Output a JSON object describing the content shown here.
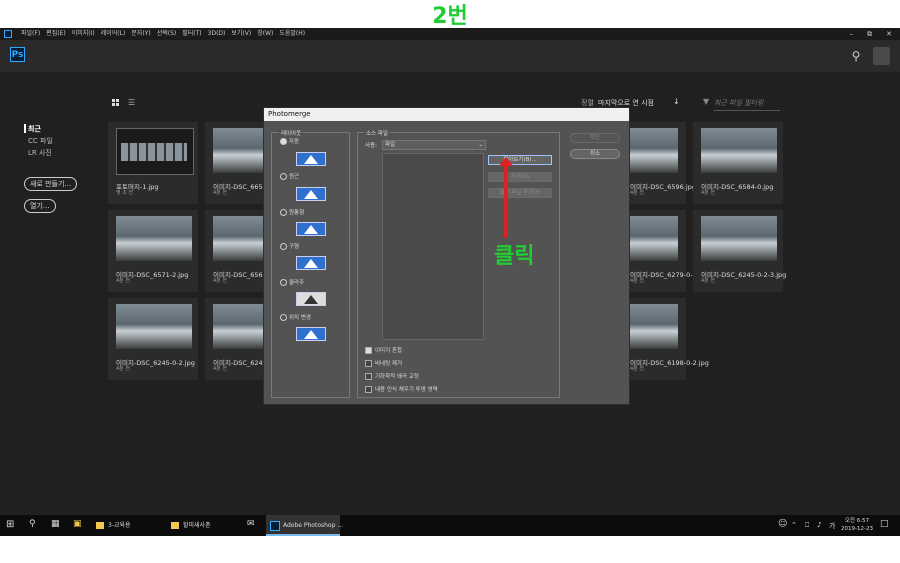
{
  "annotation": {
    "step": "2번",
    "click": "클릭"
  },
  "menubar": {
    "items": [
      "파일(F)",
      "편집(E)",
      "이미지(I)",
      "레이어(L)",
      "문자(Y)",
      "선택(S)",
      "필터(T)",
      "3D(D)",
      "보기(V)",
      "창(W)",
      "도움말(H)"
    ],
    "minimize": "–",
    "restore": "⧉",
    "close": "✕"
  },
  "app": {
    "logo": "Ps"
  },
  "home": {
    "sort_label": "정렬",
    "sort_value": "마지막으로 연 시점",
    "filter_placeholder": "최근 파일 필터링",
    "sidebar": {
      "recent": "최근",
      "cc_files": "CC 파일",
      "lr_photos": "LR 사진",
      "new_button": "새로 만들기...",
      "open_button": "열기..."
    },
    "files": [
      {
        "name": "포토머지-1.jpg",
        "time": "몇 초 전"
      },
      {
        "name": "이미지-DSC_6654",
        "time": "4분 전"
      },
      {
        "name": "이미지-DSC_6596.jpg",
        "time": "4분 전"
      },
      {
        "name": "이미지-DSC_6584-0.jpg",
        "time": "4분 전"
      },
      {
        "name": "이미지-DSC_6571-2.jpg",
        "time": "4분 전"
      },
      {
        "name": "이미지-DSC_6562",
        "time": "4분 전"
      },
      {
        "name": "이미지-DSC_6279-0-2-0.jpg",
        "time": "4분 전"
      },
      {
        "name": "이미지-DSC_6245-0-2-3.jpg",
        "time": "4분 전"
      },
      {
        "name": "이미지-DSC_6245-0-2.jpg",
        "time": "4분 전"
      },
      {
        "name": "이미지-DSC_6245",
        "time": "4분 전"
      },
      {
        "name": "이미지-DSC_6198-0-2.jpg",
        "time": "4분 전"
      }
    ]
  },
  "dialog": {
    "title": "Photomerge",
    "layout_label": "레이아웃",
    "layouts": [
      "자동",
      "원근",
      "원통형",
      "구형",
      "콜라주",
      "위치 변경"
    ],
    "source_label": "소스 파일",
    "use_label": "사용:",
    "use_value": "파일",
    "browse": "찾아보기(B)...",
    "remove": "제거(R)",
    "add_open": "열린 파일 추가(F)",
    "ok": "확인",
    "cancel": "취소",
    "options": [
      "이미지 혼합",
      "비네팅 제거",
      "기하학적 왜곡 교정",
      "내용 인식 채우기 투명 영역"
    ]
  },
  "taskbar": {
    "folder1": "3-교육용",
    "folder2": "할미새사촌",
    "photoshop": "Adobe Photoshop ...",
    "ime": "가",
    "time": "오전 6:57",
    "date": "2019-12-23"
  },
  "colors": {
    "accent": "#31a8ff",
    "annotation": "#22cc33",
    "arrow": "#e02020"
  }
}
